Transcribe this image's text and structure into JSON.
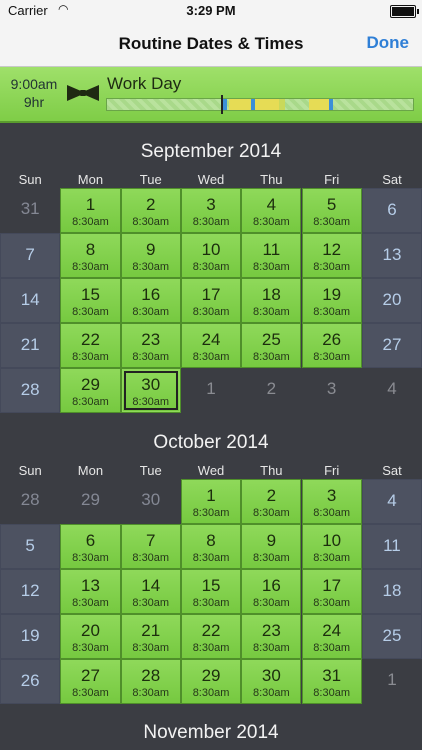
{
  "status": {
    "carrier": "Carrier",
    "time": "3:29 PM"
  },
  "nav": {
    "title": "Routine Dates & Times",
    "done": "Done"
  },
  "routine": {
    "start": "9:00am",
    "duration": "9hr",
    "name": "Work Day"
  },
  "weekdays": [
    "Sun",
    "Mon",
    "Tue",
    "Wed",
    "Thu",
    "Fri",
    "Sat"
  ],
  "months": [
    {
      "title": "September 2014",
      "weeks": [
        [
          {
            "d": "31",
            "t": "dim"
          },
          {
            "d": "1",
            "t": "work",
            "s": "8:30am"
          },
          {
            "d": "2",
            "t": "work",
            "s": "8:30am"
          },
          {
            "d": "3",
            "t": "work",
            "s": "8:30am"
          },
          {
            "d": "4",
            "t": "work",
            "s": "8:30am"
          },
          {
            "d": "5",
            "t": "work",
            "s": "8:30am"
          },
          {
            "d": "6",
            "t": "weekend"
          }
        ],
        [
          {
            "d": "7",
            "t": "weekend"
          },
          {
            "d": "8",
            "t": "work",
            "s": "8:30am"
          },
          {
            "d": "9",
            "t": "work",
            "s": "8:30am"
          },
          {
            "d": "10",
            "t": "work",
            "s": "8:30am"
          },
          {
            "d": "11",
            "t": "work",
            "s": "8:30am"
          },
          {
            "d": "12",
            "t": "work",
            "s": "8:30am"
          },
          {
            "d": "13",
            "t": "weekend"
          }
        ],
        [
          {
            "d": "14",
            "t": "weekend"
          },
          {
            "d": "15",
            "t": "work",
            "s": "8:30am"
          },
          {
            "d": "16",
            "t": "work",
            "s": "8:30am"
          },
          {
            "d": "17",
            "t": "work",
            "s": "8:30am"
          },
          {
            "d": "18",
            "t": "work",
            "s": "8:30am"
          },
          {
            "d": "19",
            "t": "work",
            "s": "8:30am"
          },
          {
            "d": "20",
            "t": "weekend"
          }
        ],
        [
          {
            "d": "21",
            "t": "weekend"
          },
          {
            "d": "22",
            "t": "work",
            "s": "8:30am"
          },
          {
            "d": "23",
            "t": "work",
            "s": "8:30am"
          },
          {
            "d": "24",
            "t": "work",
            "s": "8:30am"
          },
          {
            "d": "25",
            "t": "work",
            "s": "8:30am"
          },
          {
            "d": "26",
            "t": "work",
            "s": "8:30am"
          },
          {
            "d": "27",
            "t": "weekend"
          }
        ],
        [
          {
            "d": "28",
            "t": "weekend"
          },
          {
            "d": "29",
            "t": "work",
            "s": "8:30am"
          },
          {
            "d": "30",
            "t": "work",
            "s": "8:30am",
            "sel": true
          },
          {
            "d": "1",
            "t": "empty"
          },
          {
            "d": "2",
            "t": "empty"
          },
          {
            "d": "3",
            "t": "empty"
          },
          {
            "d": "4",
            "t": "empty"
          }
        ]
      ]
    },
    {
      "title": "October 2014",
      "weeks": [
        [
          {
            "d": "28",
            "t": "dim"
          },
          {
            "d": "29",
            "t": "dim"
          },
          {
            "d": "30",
            "t": "dim"
          },
          {
            "d": "1",
            "t": "work",
            "s": "8:30am"
          },
          {
            "d": "2",
            "t": "work",
            "s": "8:30am"
          },
          {
            "d": "3",
            "t": "work",
            "s": "8:30am"
          },
          {
            "d": "4",
            "t": "weekend"
          }
        ],
        [
          {
            "d": "5",
            "t": "weekend"
          },
          {
            "d": "6",
            "t": "work",
            "s": "8:30am"
          },
          {
            "d": "7",
            "t": "work",
            "s": "8:30am"
          },
          {
            "d": "8",
            "t": "work",
            "s": "8:30am"
          },
          {
            "d": "9",
            "t": "work",
            "s": "8:30am"
          },
          {
            "d": "10",
            "t": "work",
            "s": "8:30am"
          },
          {
            "d": "11",
            "t": "weekend"
          }
        ],
        [
          {
            "d": "12",
            "t": "weekend"
          },
          {
            "d": "13",
            "t": "work",
            "s": "8:30am"
          },
          {
            "d": "14",
            "t": "work",
            "s": "8:30am"
          },
          {
            "d": "15",
            "t": "work",
            "s": "8:30am"
          },
          {
            "d": "16",
            "t": "work",
            "s": "8:30am"
          },
          {
            "d": "17",
            "t": "work",
            "s": "8:30am"
          },
          {
            "d": "18",
            "t": "weekend"
          }
        ],
        [
          {
            "d": "19",
            "t": "weekend"
          },
          {
            "d": "20",
            "t": "work",
            "s": "8:30am"
          },
          {
            "d": "21",
            "t": "work",
            "s": "8:30am"
          },
          {
            "d": "22",
            "t": "work",
            "s": "8:30am"
          },
          {
            "d": "23",
            "t": "work",
            "s": "8:30am"
          },
          {
            "d": "24",
            "t": "work",
            "s": "8:30am"
          },
          {
            "d": "25",
            "t": "weekend"
          }
        ],
        [
          {
            "d": "26",
            "t": "weekend"
          },
          {
            "d": "27",
            "t": "work",
            "s": "8:30am"
          },
          {
            "d": "28",
            "t": "work",
            "s": "8:30am"
          },
          {
            "d": "29",
            "t": "work",
            "s": "8:30am"
          },
          {
            "d": "30",
            "t": "work",
            "s": "8:30am"
          },
          {
            "d": "31",
            "t": "work",
            "s": "8:30am"
          },
          {
            "d": "1",
            "t": "empty"
          }
        ]
      ]
    },
    {
      "title": "November 2014",
      "weeks": []
    }
  ],
  "colors": {
    "accent": "#2f7fd6",
    "work": "#7fcd47",
    "weekend": "#4d5261"
  }
}
